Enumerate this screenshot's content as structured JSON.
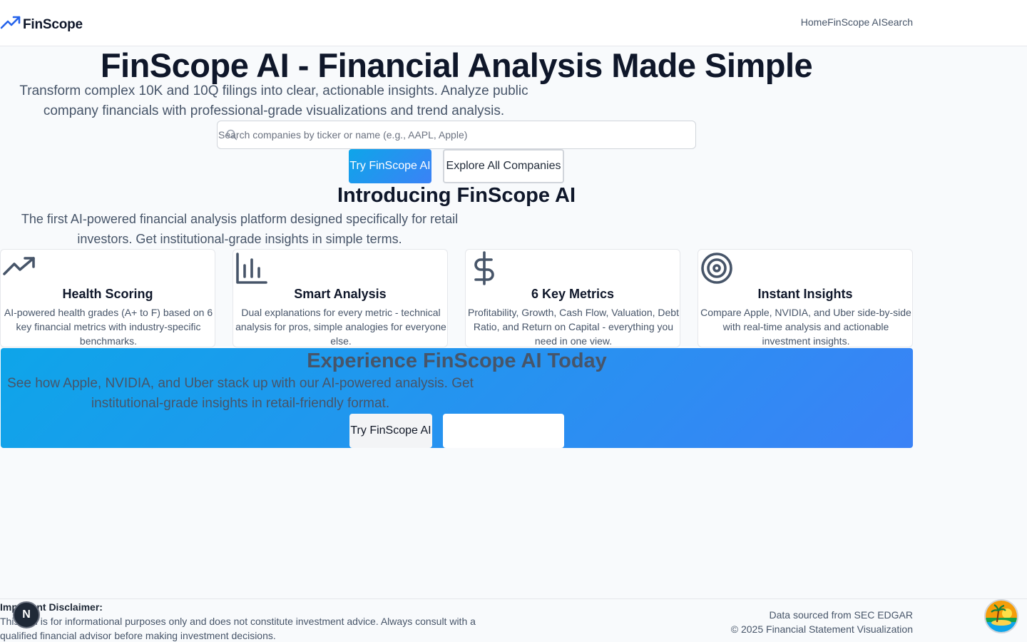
{
  "header": {
    "brand": "FinScope",
    "nav": [
      "Home",
      "FinScope AI",
      "Search"
    ]
  },
  "hero": {
    "title": "FinScope AI - Financial Analysis Made Simple",
    "subtitle": "Transform complex 10K and 10Q filings into clear, actionable insights. Analyze public company financials with professional-grade visualizations and trend analysis.",
    "search_placeholder": "Search companies by ticker or name (e.g., AAPL, Apple)",
    "primary_button": "Try FinScope AI",
    "secondary_button": "Explore All Companies"
  },
  "intro": {
    "title": "Introducing FinScope AI",
    "subtitle": "The first AI-powered financial analysis platform designed specifically for retail investors. Get institutional-grade insights in simple terms."
  },
  "features": [
    {
      "icon": "trending-up-icon",
      "title": "Health Scoring",
      "description": "AI-powered health grades (A+ to F) based on 6 key financial metrics with industry-specific benchmarks."
    },
    {
      "icon": "bar-chart-icon",
      "title": "Smart Analysis",
      "description": "Dual explanations for every metric - technical analysis for pros, simple analogies for everyone else."
    },
    {
      "icon": "dollar-icon",
      "title": "6 Key Metrics",
      "description": "Profitability, Growth, Cash Flow, Valuation, Debt Ratio, and Return on Capital - everything you need in one view."
    },
    {
      "icon": "target-icon",
      "title": "Instant Insights",
      "description": "Compare Apple, NVIDIA, and Uber side-by-side with real-time analysis and actionable investment insights."
    }
  ],
  "cta": {
    "title": "Experience FinScope AI Today",
    "subtitle": "See how Apple, NVIDIA, and Uber stack up with our AI-powered analysis. Get institutional-grade insights in retail-friendly format.",
    "primary_button": "Try FinScope AI"
  },
  "footer": {
    "disclaimer_title": "Important Disclaimer:",
    "disclaimer_text": "This tool is for informational purposes only and does not constitute investment advice. Always consult with a qualified financial advisor before making investment decisions.",
    "source": "Data sourced from SEC EDGAR",
    "copyright": "© 2025 Financial Statement Visualization"
  },
  "overlay": {
    "dev_badge": "N"
  },
  "colors": {
    "accent_start": "#0ea5e9",
    "accent_end": "#3b82f6",
    "text_dark": "#0f172a",
    "text_muted": "#475569"
  }
}
